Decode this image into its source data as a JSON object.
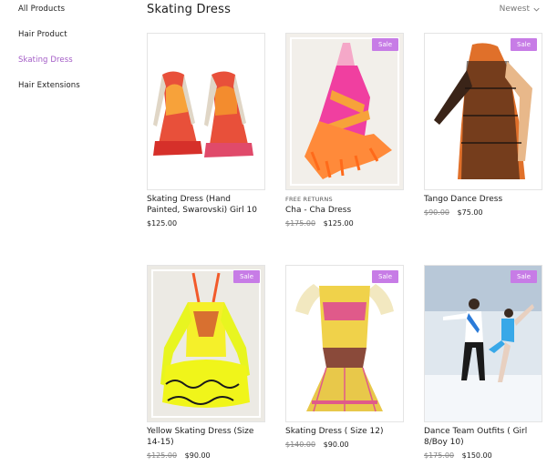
{
  "sidebar": {
    "items": [
      {
        "label": "All Products"
      },
      {
        "label": "Hair Product"
      },
      {
        "label": "Skating Dress",
        "active": true
      },
      {
        "label": "Hair Extensions"
      }
    ]
  },
  "header": {
    "title": "Skating Dress",
    "sort_label": "Newest",
    "sort_icon": "chevron-down-icon"
  },
  "colors": {
    "accent": "#a35bc6",
    "badge": "#c77ce6"
  },
  "products": [
    {
      "name": "Skating Dress (Hand Painted, Swarovski) Girl 10",
      "price": "$125.00",
      "old_price": "",
      "badge": "",
      "ribbon": ""
    },
    {
      "name": "Cha - Cha Dress",
      "price": "$125.00",
      "old_price": "$175.00",
      "badge": "Sale",
      "ribbon": "FREE RETURNS"
    },
    {
      "name": "Tango Dance Dress",
      "price": "$75.00",
      "old_price": "$90.00",
      "badge": "Sale",
      "ribbon": ""
    },
    {
      "name": "Yellow Skating Dress (Size 14-15)",
      "price": "$90.00",
      "old_price": "$125.00",
      "badge": "Sale",
      "ribbon": ""
    },
    {
      "name": "Skating Dress ( Size 12)",
      "price": "$90.00",
      "old_price": "$140.00",
      "badge": "Sale",
      "ribbon": ""
    },
    {
      "name": "Dance Team Outfits ( Girl 8/Boy 10)",
      "price": "$150.00",
      "old_price": "$175.00",
      "badge": "Sale",
      "ribbon": ""
    }
  ]
}
